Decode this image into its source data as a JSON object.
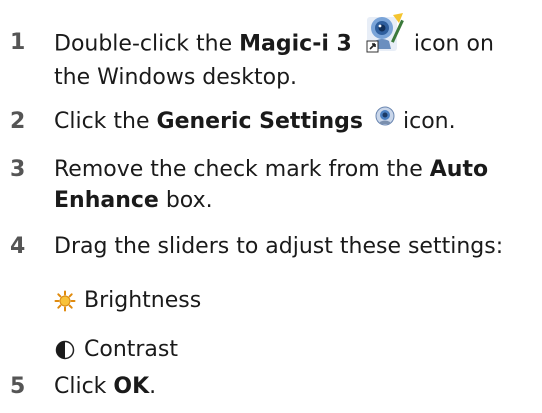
{
  "steps": [
    {
      "number": "1",
      "pre": "Double-click the ",
      "bold": "Magic-i 3",
      "icon": "magic-i-webcam-icon",
      "post_line1": " icon on",
      "line2": "the Windows desktop."
    },
    {
      "number": "2",
      "pre": "Click the ",
      "bold": "Generic Settings",
      "icon": "generic-settings-icon",
      "post": " icon."
    },
    {
      "number": "3",
      "pre": "Remove the check mark from the ",
      "bold1": "Auto",
      "bold2": "Enhance",
      "post": " box."
    },
    {
      "number": "4",
      "text": "Drag the sliders to adjust these settings:",
      "items": [
        {
          "icon": "brightness-icon",
          "label": "Brightness"
        },
        {
          "icon": "contrast-icon",
          "label": "Contrast"
        }
      ]
    },
    {
      "number": "5",
      "pre": "Click ",
      "bold": "OK",
      "post": "."
    }
  ],
  "colors": {
    "text": "#1a1a1a",
    "number": "#555555",
    "sun": "#f2a81c",
    "webcam": "#4a7fc1"
  }
}
